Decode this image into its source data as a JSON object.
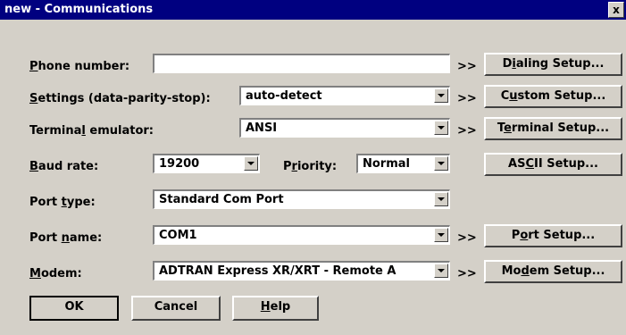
{
  "window": {
    "title": "new - Communications",
    "close_glyph": "x"
  },
  "form": {
    "phone_number": {
      "label_pre": "",
      "label_key": "P",
      "label_post": "hone number:",
      "value": ""
    },
    "settings": {
      "label_pre": "",
      "label_key": "S",
      "label_post": "ettings (data-parity-stop):",
      "value": "auto-detect"
    },
    "terminal_emulator": {
      "label_pre": "Termina",
      "label_key": "l",
      "label_post": " emulator:",
      "value": "ANSI"
    },
    "baud_rate": {
      "label_pre": "",
      "label_key": "B",
      "label_post": "aud rate:",
      "value": "19200"
    },
    "priority": {
      "label_pre": "P",
      "label_key": "r",
      "label_post": "iority:",
      "value": "Normal"
    },
    "port_type": {
      "label_pre": "Port ",
      "label_key": "t",
      "label_post": "ype:",
      "value": "Standard Com Port"
    },
    "port_name": {
      "label_pre": "Port ",
      "label_key": "n",
      "label_post": "ame:",
      "value": "COM1"
    },
    "modem": {
      "label_pre": "",
      "label_key": "M",
      "label_post": "odem:",
      "value": "ADTRAN Express XR/XRT - Remote A"
    }
  },
  "chevron": ">>",
  "side_buttons": {
    "dialing": {
      "pre": "D",
      "key": "i",
      "post": "aling Setup..."
    },
    "custom": {
      "pre": "C",
      "key": "u",
      "post": "stom Setup..."
    },
    "terminal": {
      "pre": "T",
      "key": "e",
      "post": "rminal Setup..."
    },
    "ascii": {
      "pre": "AS",
      "key": "C",
      "post": "II Setup..."
    },
    "port": {
      "pre": "P",
      "key": "o",
      "post": "rt Setup..."
    },
    "modem": {
      "pre": "Mo",
      "key": "d",
      "post": "em Setup..."
    }
  },
  "footer": {
    "ok": "OK",
    "cancel": "Cancel",
    "help": {
      "pre": "",
      "key": "H",
      "post": "elp"
    }
  }
}
